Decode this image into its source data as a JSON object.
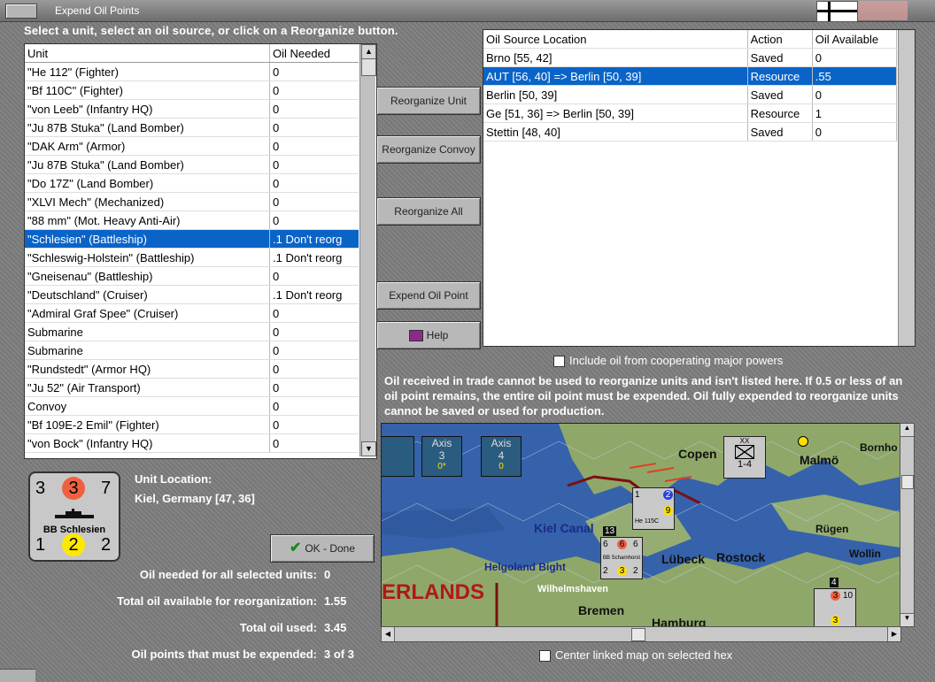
{
  "window": {
    "title": "Expend Oil Points"
  },
  "instruction": "Select a unit, select an oil source, or click on a Reorganize button.",
  "units_table": {
    "headers": [
      "Unit",
      "Oil Needed"
    ],
    "rows": [
      [
        "\"He 112\" (Fighter)",
        "0"
      ],
      [
        "\"Bf 110C\" (Fighter)",
        "0"
      ],
      [
        "\"von Leeb\" (Infantry HQ)",
        "0"
      ],
      [
        "\"Ju 87B Stuka\" (Land Bomber)",
        "0"
      ],
      [
        "\"DAK Arm\" (Armor)",
        "0"
      ],
      [
        "\"Ju 87B Stuka\" (Land Bomber)",
        "0"
      ],
      [
        "\"Do 17Z\" (Land Bomber)",
        "0"
      ],
      [
        "\"XLVI Mech\" (Mechanized)",
        "0"
      ],
      [
        "\"88 mm\" (Mot. Heavy Anti-Air)",
        "0"
      ],
      [
        "\"Schlesien\" (Battleship)",
        ".1 Don't reorg"
      ],
      [
        "\"Schleswig-Holstein\" (Battleship)",
        ".1 Don't reorg"
      ],
      [
        "\"Gneisenau\" (Battleship)",
        "0"
      ],
      [
        "\"Deutschland\" (Cruiser)",
        ".1 Don't reorg"
      ],
      [
        "\"Admiral Graf Spee\" (Cruiser)",
        "0"
      ],
      [
        "Submarine",
        "0"
      ],
      [
        "Submarine",
        "0"
      ],
      [
        "\"Rundstedt\" (Armor HQ)",
        "0"
      ],
      [
        "\"Ju 52\" (Air Transport)",
        "0"
      ],
      [
        "Convoy",
        "0"
      ],
      [
        "\"Bf 109E-2 Emil\" (Fighter)",
        "0"
      ],
      [
        "\"von Bock\" (Infantry HQ)",
        "0"
      ]
    ],
    "selected_index": 9
  },
  "buttons": {
    "reorganize_unit": "Reorganize Unit",
    "reorganize_convoy": "Reorganize Convoy",
    "reorganize_all": "Reorganize All",
    "expend_oil_point": "Expend Oil Point",
    "help": "Help",
    "ok_done": "OK - Done"
  },
  "source_table": {
    "headers": [
      "Oil Source Location",
      "Action",
      "Oil Available"
    ],
    "rows": [
      [
        "Brno [55, 42]",
        "Saved",
        "0"
      ],
      [
        "AUT [56, 40] => Berlin [50, 39]",
        "Resource",
        ".55"
      ],
      [
        "Berlin [50, 39]",
        "Saved",
        "0"
      ],
      [
        "Ge [51, 36] => Berlin [50, 39]",
        "Resource",
        "1"
      ],
      [
        "Stettin [48, 40]",
        "Saved",
        "0"
      ]
    ],
    "selected_index": 1
  },
  "include_oil_label": "Include oil from cooperating major powers",
  "note": "Oil received in trade cannot be used to reorganize units and isn't listed here.  If 0.5 or less of an oil point remains, the entire oil point must be expended.   Oil fully expended to reorganize units cannot be saved or used for production.",
  "unit_card": {
    "name": "BB Schlesien",
    "top_left": "3",
    "top_mid": "3",
    "top_right": "7",
    "bottom_left": "1",
    "bottom_mid": "2",
    "bottom_right": "2",
    "top_mid_color": "#f06040",
    "bottom_mid_color": "#ffe800"
  },
  "unit_location": {
    "label": "Unit Location:",
    "value": "Kiel, Germany [47, 36]"
  },
  "stats": [
    {
      "label": "Oil needed for all selected units:",
      "value": "0"
    },
    {
      "label": "Total oil available for reorganization:",
      "value": "1.55"
    },
    {
      "label": "Total oil used:",
      "value": "3.45"
    },
    {
      "label": "Oil points that must be expended:",
      "value": "3 of 3"
    }
  ],
  "center_map_label": "Center linked map on selected hex",
  "map": {
    "axis_boxes": [
      {
        "title": "Axis",
        "num": "3",
        "sub": "0*"
      },
      {
        "title": "Axis",
        "num": "4",
        "sub": "0"
      }
    ],
    "labels": [
      "Copen",
      "Malmö",
      "Bornho",
      "Kiel Canal",
      "Helgoland Bight",
      "Rügen",
      "Wollin",
      "Lübeck",
      "Rostock",
      "ERLANDS",
      "Wilhelmshaven",
      "Bremen",
      "Hamburg"
    ],
    "counters": {
      "corps": {
        "type": "XX",
        "value": "1-4"
      },
      "fighter": {
        "a": "1",
        "b": "2",
        "c": "9",
        "name": "He 115C",
        "d": "2"
      },
      "battleship": {
        "top": "13",
        "a": "6",
        "b": "6",
        "c": "6",
        "name": "BB Scharnhorst",
        "d": "2",
        "e": "3",
        "f": "2"
      },
      "right": {
        "top": "4",
        "a": "3",
        "b": "10",
        "c": "3"
      }
    }
  }
}
